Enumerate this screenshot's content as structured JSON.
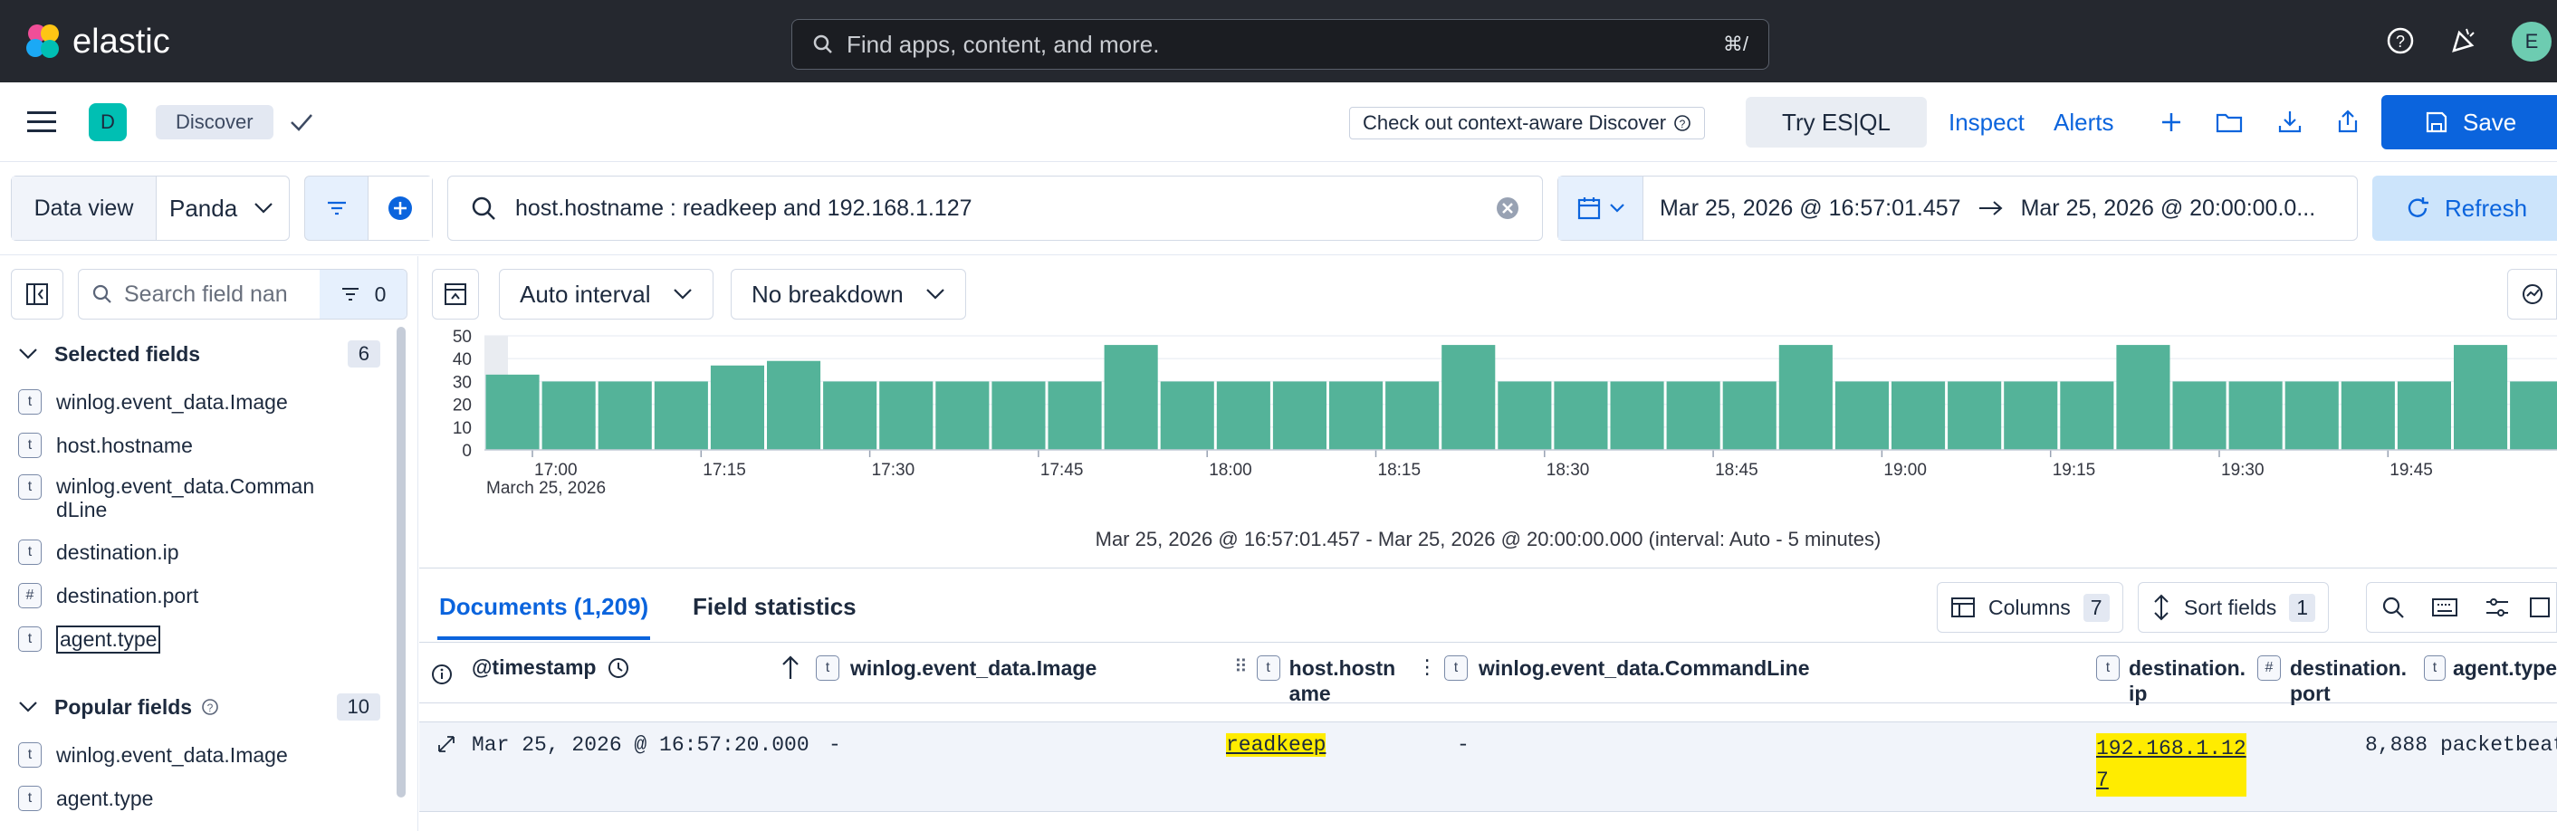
{
  "topbar": {
    "brand": "elastic",
    "search_placeholder": "Find apps, content, and more.",
    "search_shortcut": "⌘/",
    "avatar_letter": "E",
    "icons": [
      "help-icon",
      "newsfeed-icon"
    ]
  },
  "appbar": {
    "space_letter": "D",
    "breadcrumb": "Discover",
    "context_aware": "Check out context-aware Discover",
    "try_esql": "Try ES|QL",
    "inspect": "Inspect",
    "alerts": "Alerts",
    "save": "Save"
  },
  "query": {
    "data_view_label": "Data view",
    "data_view_value": "Panda",
    "query_text": "host.hostname : readkeep and 192.168.1.127",
    "time_start": "Mar 25, 2026 @ 16:57:01.457",
    "time_end": "Mar 25, 2026 @ 20:00:00.0...",
    "refresh": "Refresh"
  },
  "sidebar": {
    "search_placeholder": "Search field nan",
    "filter_count": "0",
    "selected_title": "Selected fields",
    "selected_count": "6",
    "selected": [
      {
        "type": "t",
        "name": "winlog.event_data.Image"
      },
      {
        "type": "t",
        "name": "host.hostname"
      },
      {
        "type": "t",
        "name": "winlog.event_data.Comman\ndLine"
      },
      {
        "type": "t",
        "name": "destination.ip"
      },
      {
        "type": "#",
        "name": "destination.port"
      },
      {
        "type": "t",
        "name": "agent.type"
      }
    ],
    "popular_title": "Popular fields",
    "popular_count": "10",
    "popular": [
      {
        "type": "t",
        "name": "winlog.event_data.Image"
      },
      {
        "type": "t",
        "name": "agent.type"
      }
    ]
  },
  "histogram_controls": {
    "interval": "Auto interval",
    "breakdown": "No breakdown"
  },
  "chart_data": {
    "type": "bar",
    "ylim": [
      0,
      50
    ],
    "yticks": [
      0,
      10,
      20,
      30,
      40,
      50
    ],
    "x_tick_labels": [
      "17:00",
      "17:15",
      "17:30",
      "17:45",
      "18:00",
      "18:15",
      "18:30",
      "18:45",
      "19:00",
      "19:15",
      "19:30",
      "19:45"
    ],
    "x_sub_label": "March 25, 2026",
    "values": [
      33,
      30,
      30,
      30,
      37,
      39,
      30,
      30,
      30,
      30,
      30,
      46,
      30,
      30,
      30,
      30,
      30,
      46,
      30,
      30,
      30,
      30,
      30,
      46,
      30,
      30,
      30,
      30,
      30,
      46,
      30,
      30,
      30,
      30,
      30,
      46,
      30
    ],
    "color": "#54b399",
    "caption": "Mar 25, 2026 @ 16:57:01.457 - Mar 25, 2026 @ 20:00:00.000 (interval: Auto - 5 minutes)"
  },
  "table": {
    "tab_documents": "Documents (1,209)",
    "tab_stats": "Field statistics",
    "columns_label": "Columns",
    "columns_count": "7",
    "sort_label": "Sort fields",
    "sort_count": "1",
    "headers": {
      "timestamp": "@timestamp",
      "image": "winlog.event_data.Image",
      "hostname": "host.hostn\name",
      "commandline": "winlog.event_data.CommandLine",
      "dest_ip": "destination.\nip",
      "dest_port": "destination.\nport",
      "agent": "agent.type"
    },
    "row": {
      "timestamp": "Mar 25, 2026 @ 16:57:20.000",
      "image": "-",
      "hostname": "readkeep",
      "commandline": "-",
      "dest_ip": "192.168.1.12\n7",
      "dest_port": "8,888",
      "agent": "packetbeat"
    }
  }
}
